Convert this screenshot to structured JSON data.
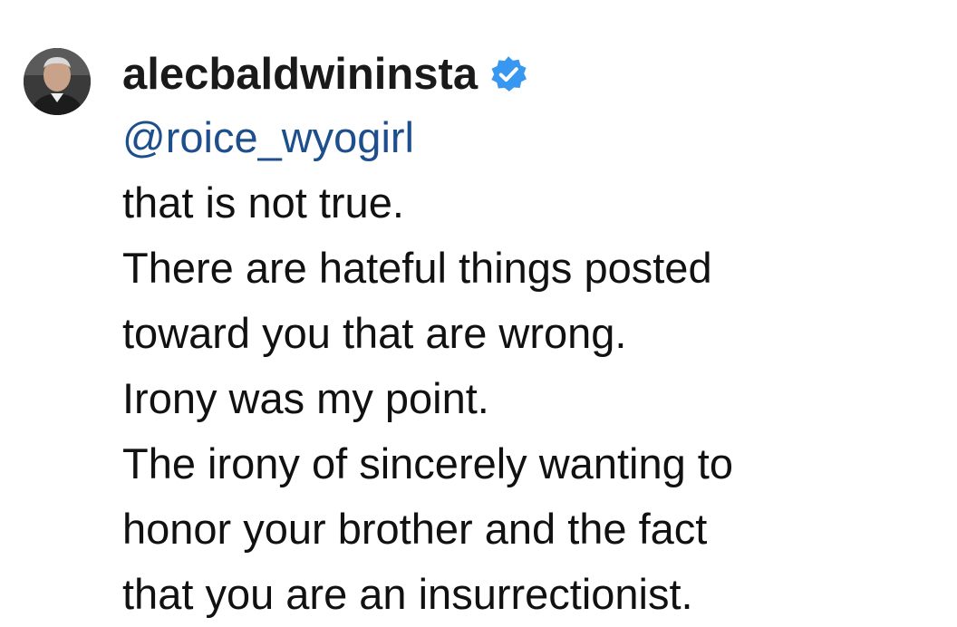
{
  "comment": {
    "username": "alecbaldwininsta",
    "verified_icon": "verified-badge-icon",
    "verified_color": "#3897f0",
    "mention": "@roice_wyogirl",
    "mention_color": "#1d4f8c",
    "lines": [
      "that is not true.",
      "There are hateful things posted",
      "toward you that are wrong.",
      "Irony was my point.",
      "The irony of sincerely wanting to",
      "honor your brother and the fact",
      "that you are an insurrectionist."
    ]
  }
}
